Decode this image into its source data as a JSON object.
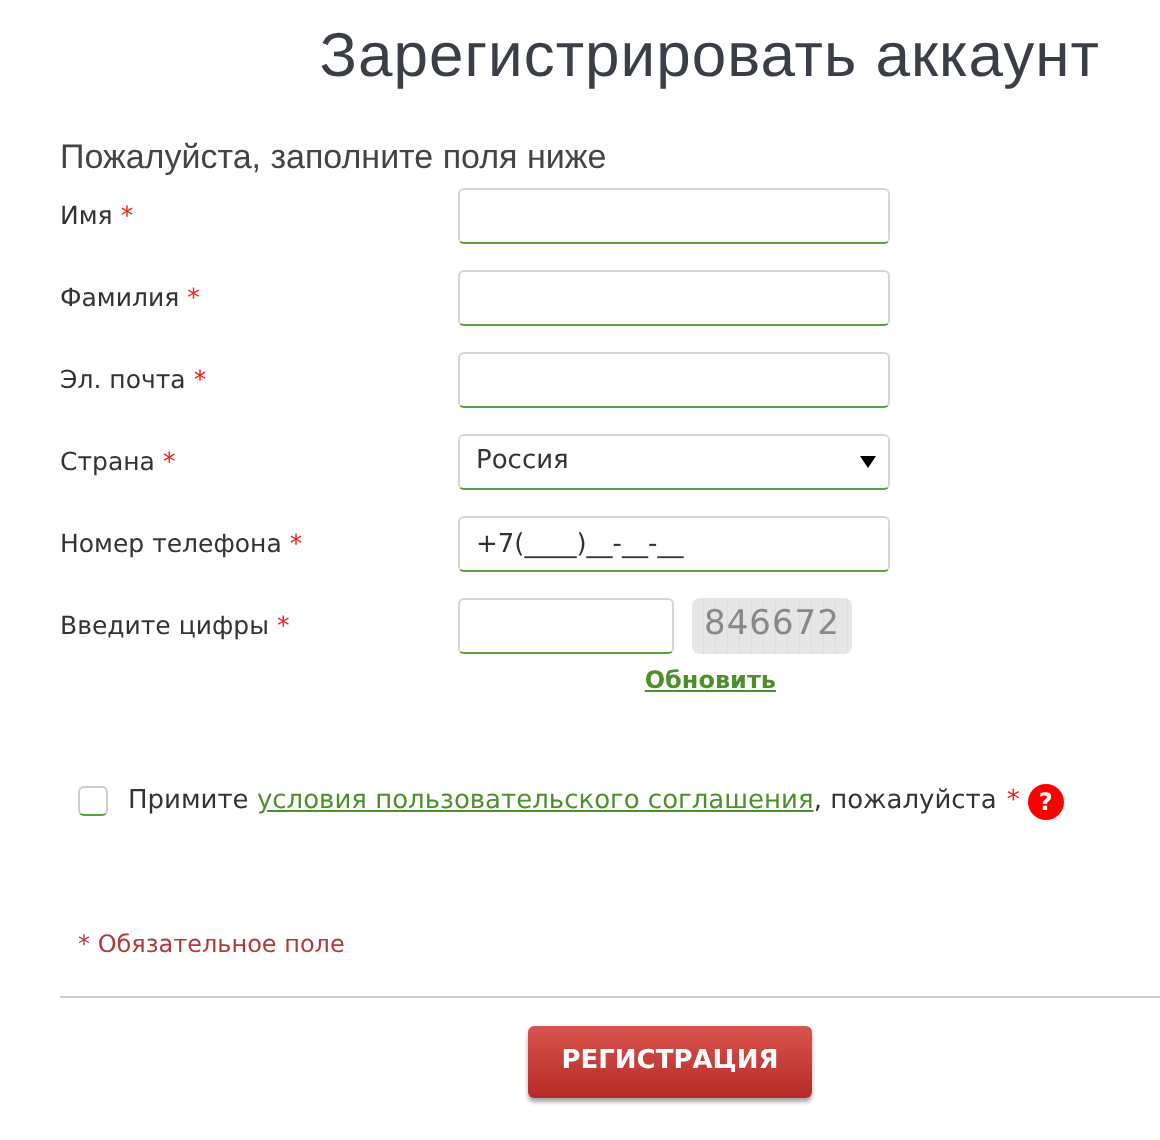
{
  "title": "Зарегистрировать аккаунт",
  "subtitle": "Пожалуйста, заполните поля ниже",
  "fields": [
    {
      "kind": "text",
      "label": "Имя",
      "mark": "*"
    },
    {
      "kind": "text",
      "label": "Фамилия",
      "mark": "*"
    },
    {
      "kind": "text",
      "label": "Эл. почта",
      "mark": "*"
    },
    {
      "kind": "select",
      "label": "Страна",
      "mark": "*",
      "value": "Россия"
    },
    {
      "kind": "text",
      "label": "Номер телефона",
      "mark": "*",
      "value": "+7(____)__-__-__"
    },
    {
      "kind": "captcha",
      "label": "Введите цифры",
      "mark": "*",
      "captcha": "846672",
      "refresh": "Обновить"
    }
  ],
  "agreement": {
    "checked": false,
    "before": "Примите ",
    "link": "условия пользовательского соглашения",
    "after": ", пожалуйста",
    "mark": "*",
    "help": "?"
  },
  "required_note": "* Обязательное поле",
  "submit": "РЕГИСТРАЦИЯ"
}
